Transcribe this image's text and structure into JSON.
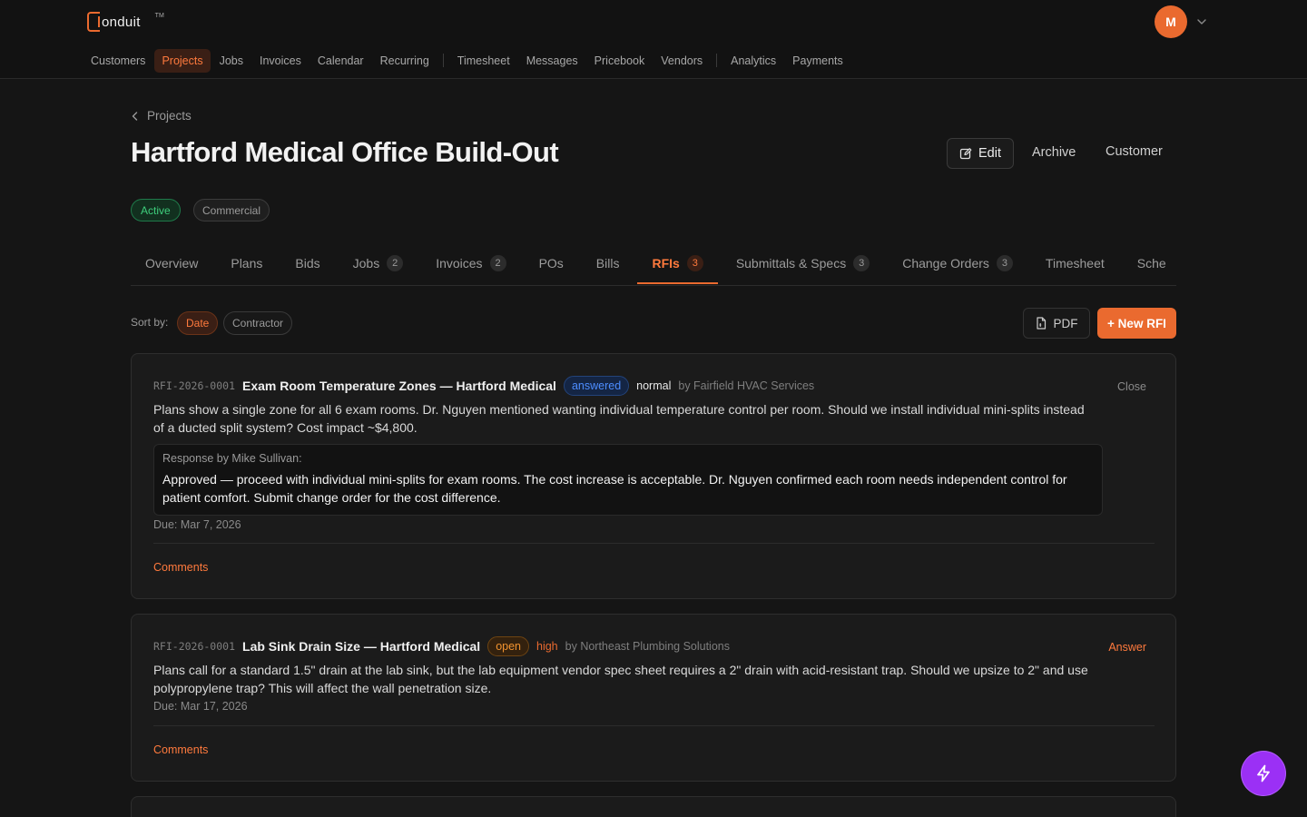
{
  "app": {
    "logo_text": "onduit",
    "logo_tm": "TM",
    "avatar_initial": "M",
    "accent": "#ea6a2f"
  },
  "nav": {
    "items": [
      {
        "label": "Customers"
      },
      {
        "label": "Projects",
        "active": true
      },
      {
        "label": "Jobs"
      },
      {
        "label": "Invoices"
      },
      {
        "label": "Calendar"
      },
      {
        "label": "Recurring"
      },
      {
        "label": "Timesheet"
      },
      {
        "label": "Messages"
      },
      {
        "label": "Pricebook"
      },
      {
        "label": "Vendors"
      },
      {
        "label": "Analytics"
      },
      {
        "label": "Payments"
      }
    ]
  },
  "page": {
    "back_label": "Projects",
    "title": "Hartford Medical Office Build-Out",
    "actions": {
      "edit": "Edit",
      "archive": "Archive",
      "customer": "Customer"
    },
    "status_badge": "Active",
    "type_badge": "Commercial"
  },
  "tabs": [
    {
      "label": "Overview",
      "count": null
    },
    {
      "label": "Plans",
      "count": null
    },
    {
      "label": "Bids",
      "count": null
    },
    {
      "label": "Jobs",
      "count": "2"
    },
    {
      "label": "Invoices",
      "count": "2"
    },
    {
      "label": "POs",
      "count": null
    },
    {
      "label": "Bills",
      "count": null
    },
    {
      "label": "RFIs",
      "count": "3",
      "active": true
    },
    {
      "label": "Submittals & Specs",
      "count": "3"
    },
    {
      "label": "Change Orders",
      "count": "3"
    },
    {
      "label": "Timesheet",
      "count": null
    },
    {
      "label": "Sche",
      "count": null
    }
  ],
  "toolbar": {
    "sort_label": "Sort by:",
    "sort_date": "Date",
    "sort_contractor": "Contractor",
    "pdf_label": "PDF",
    "new_label": "+ New RFI"
  },
  "rfis": [
    {
      "number": "RFI-2026-0001",
      "title": "Exam Room Temperature Zones — Hartford Medical",
      "status": "answered",
      "priority": "normal",
      "by": "by Fairfield HVAC Services",
      "action": "Close",
      "question": "Plans show a single zone for all 6 exam rooms. Dr. Nguyen mentioned wanting individual temperature control per room. Should we install individual mini-splits instead of a ducted split system? Cost impact ~$4,800.",
      "response_label": "Response by Mike Sullivan:",
      "response": "Approved — proceed with individual mini-splits for exam rooms. The cost increase is acceptable. Dr. Nguyen confirmed each room needs independent control for patient comfort. Submit change order for the cost difference.",
      "due": "Due: Mar 7, 2026",
      "comments": "Comments"
    },
    {
      "number": "RFI-2026-0001",
      "title": "Lab Sink Drain Size — Hartford Medical",
      "status": "open",
      "priority": "high",
      "by": "by Northeast Plumbing Solutions",
      "action": "Answer",
      "question": "Plans call for a standard 1.5\" drain at the lab sink, but the lab equipment vendor spec sheet requires a 2\" drain with acid-resistant trap. Should we upsize to 2\" and use polypropylene trap? This will affect the wall penetration size.",
      "due": "Due: Mar 17, 2026",
      "comments": "Comments"
    }
  ]
}
